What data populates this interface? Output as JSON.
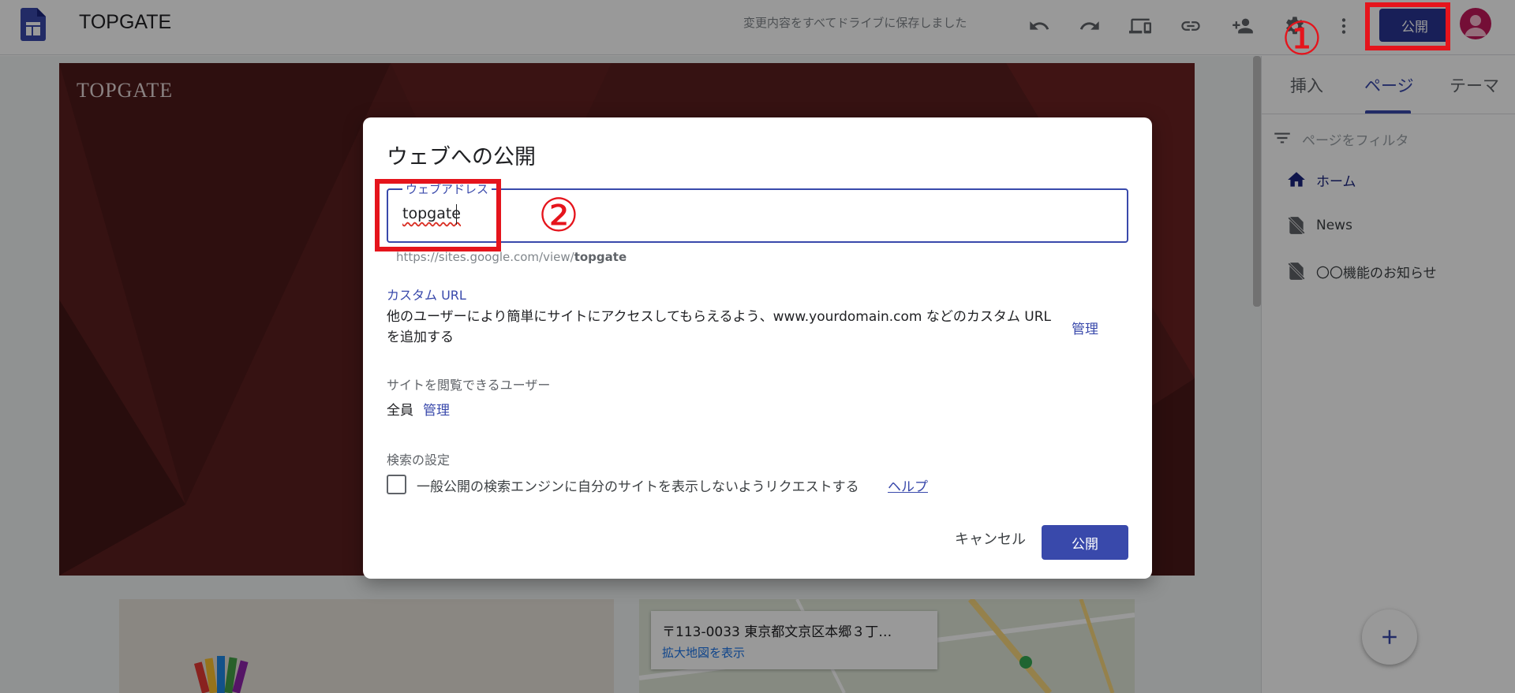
{
  "app": {
    "title": "TOPGATE",
    "save_status": "変更内容をすべてドライブに保存しました"
  },
  "toolbar": {
    "icons": [
      "undo-icon",
      "redo-icon",
      "preview-icon",
      "link-icon",
      "share-icon",
      "settings-icon",
      "more-vert-icon"
    ],
    "publish_label": "公開"
  },
  "hero": {
    "site_title": "TOPGATE"
  },
  "map": {
    "address": "〒113-0033 東京都文京区本郷３丁…",
    "link": "拡大地図を表示"
  },
  "panel": {
    "tabs": [
      {
        "label": "挿入"
      },
      {
        "label": "ページ"
      },
      {
        "label": "テーマ"
      }
    ],
    "active_tab": "ページ",
    "filter_placeholder": "ページをフィルタ",
    "pages": [
      {
        "label": "ホーム"
      },
      {
        "label": "News"
      },
      {
        "label": "〇〇機能のお知らせ"
      }
    ]
  },
  "dialog": {
    "title": "ウェブへの公開",
    "address_label": "ウェブアドレス",
    "address_value": "topgate",
    "url_prefix": "https://sites.google.com/view/",
    "url_slug": "topgate",
    "custom_url_heading": "カスタム URL",
    "custom_url_desc": "他のユーザーにより簡単にサイトにアクセスしてもらえるよう、www.yourdomain.com などのカスタム URL を追加する",
    "manage_label": "管理",
    "viewers_heading": "サイトを閲覧できるユーザー",
    "viewers_value": "全員",
    "viewers_manage": "管理",
    "search_heading": "検索の設定",
    "search_checkbox_label": "一般公開の検索エンジンに自分のサイトを表示しないようリクエストする",
    "help_link": "ヘルプ",
    "cancel_label": "キャンセル",
    "publish_label": "公開"
  },
  "annotations": {
    "step1": "①",
    "step2": "②",
    "color": "#e5141c"
  },
  "colors": {
    "accent": "#3949ab",
    "hero": "#5a1e1e"
  }
}
